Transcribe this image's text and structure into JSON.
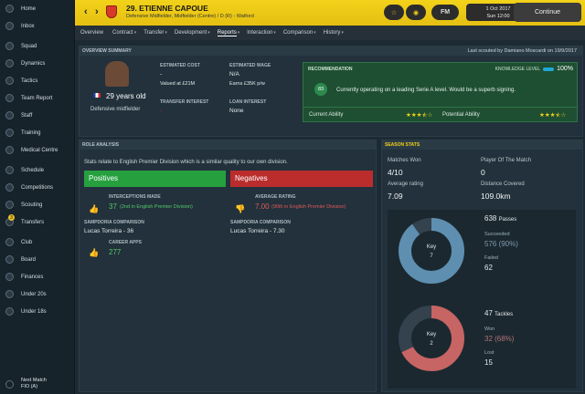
{
  "sidebar": {
    "items": [
      {
        "label": "Home",
        "icon": "home-icon"
      },
      {
        "label": "Inbox",
        "icon": "mail-icon"
      },
      {
        "label": "Squad",
        "icon": "people-icon"
      },
      {
        "label": "Dynamics",
        "icon": "dynamics-icon"
      },
      {
        "label": "Tactics",
        "icon": "tactics-icon"
      },
      {
        "label": "Team Report",
        "icon": "report-icon"
      },
      {
        "label": "Staff",
        "icon": "staff-icon"
      },
      {
        "label": "Training",
        "icon": "training-icon"
      },
      {
        "label": "Medical Centre",
        "icon": "medical-icon"
      },
      {
        "label": "Schedule",
        "icon": "calendar-icon"
      },
      {
        "label": "Competitions",
        "icon": "trophy-icon"
      },
      {
        "label": "Scouting",
        "icon": "scouting-icon"
      },
      {
        "label": "Transfers",
        "icon": "transfers-icon"
      },
      {
        "label": "Club",
        "icon": "club-icon"
      },
      {
        "label": "Board",
        "icon": "board-icon"
      },
      {
        "label": "Finances",
        "icon": "money-icon"
      },
      {
        "label": "Under 20s",
        "icon": "u20-icon"
      },
      {
        "label": "Under 18s",
        "icon": "u18-icon"
      }
    ],
    "transfers_badge": "3",
    "next_match_label": "Next Match",
    "next_match_value": "FIO (A)"
  },
  "header": {
    "player_name": "29. ETIENNE CAPOUE",
    "player_sub": "Defensive Midfielder, Midfielder (Centre) / D (R) - Watford",
    "date_line1": "1 Oct 2017",
    "date_line2": "Sun 12:00",
    "continue_label": "Continue",
    "fm_label": "FM",
    "back_arrow": "‹",
    "forward_arrow": "›",
    "star_glyph": "☆",
    "globe_glyph": "◉"
  },
  "tabs": [
    "Overview",
    "Contract",
    "Transfer",
    "Development",
    "Reports",
    "Interaction",
    "Comparison",
    "History"
  ],
  "active_tab": "Reports",
  "overview": {
    "section_title": "OVERVIEW SUMMARY",
    "scouted_by": "Last scouted by Damiano Moscardi on 19/9/2017",
    "age": "29 years old",
    "role": "Defensive midfielder",
    "estimated_cost_label": "ESTIMATED COST",
    "estimated_cost_value": "-",
    "valued_at": "Valued at £21M",
    "estimated_wage_label": "ESTIMATED WAGE",
    "estimated_wage_value": "N/A",
    "earns": "Earns £35K p/w",
    "transfer_interest_label": "TRANSFER INTEREST",
    "transfer_interest_value": "-",
    "loan_interest_label": "LOAN INTEREST",
    "loan_interest_value": "None"
  },
  "recommendation": {
    "title": "RECOMMENDATION",
    "knowledge_label": "KNOWLEDGE LEVEL",
    "knowledge_pct": "100%",
    "score": "83",
    "text": "Currently operating on a leading Serie A level. Would be a superb signing.",
    "current_ability_label": "Current Ability",
    "current_ability_stars": 3.5,
    "potential_ability_label": "Potential Ability",
    "potential_ability_stars": 3.5
  },
  "role_analysis": {
    "title": "ROLE ANALYSIS",
    "description": "Stats relate to English Premier Division which is a similar quality to our own division.",
    "positives_label": "Positives",
    "negatives_label": "Negatives",
    "positives": [
      {
        "label": "INTERCEPTIONS MADE",
        "value": "37",
        "note": "(2nd in English Premier Division)",
        "icon": "thumbs-up-icon"
      },
      {
        "label": "SAMPDORIA COMPARISON",
        "value": "Lucas Torreira - 36"
      },
      {
        "label": "CAREER APPS",
        "value": "277",
        "icon": "thumbs-up-icon"
      }
    ],
    "negatives": [
      {
        "label": "AVERAGE RATING",
        "value": "7.00",
        "note": "(90th in English Premier Division)",
        "icon": "thumbs-down-icon"
      },
      {
        "label": "SAMPDORIA COMPARISON",
        "value": "Lucas Torreira - 7.30"
      }
    ]
  },
  "season_stats": {
    "title": "SEASON STATS",
    "matches_won_label": "Matches Won",
    "matches_won": "4/10",
    "potm_label": "Player Of The Match",
    "potm": "0",
    "avg_rating_label": "Average rating",
    "avg_rating": "7.09",
    "distance_label": "Distance Covered",
    "distance": "109.0km",
    "passes": {
      "key_label": "Key",
      "key": "7",
      "total": "638",
      "label": "Passes",
      "succeeded_label": "Succeeded",
      "succeeded": "576 (90%)",
      "failed_label": "Failed",
      "failed": "62",
      "success_fraction": 0.9
    },
    "tackles": {
      "key_label": "Key",
      "key": "2",
      "total": "47",
      "label": "Tackles",
      "won_label": "Won",
      "won": "32 (68%)",
      "lost_label": "Lost",
      "lost": "15",
      "success_fraction": 0.68
    }
  },
  "colors": {
    "accent": "#f2d21a",
    "positive": "#26a03f",
    "negative": "#bb2d2d",
    "passes_ring": "#5e8fb0",
    "tackles_ring": "#c76464"
  }
}
